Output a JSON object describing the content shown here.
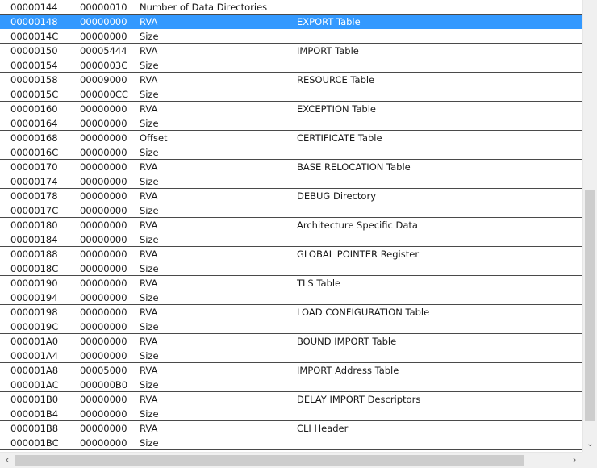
{
  "rows": [
    {
      "offset": "00000144",
      "data": "00000010",
      "desc": "Number of Data Directories",
      "value": ""
    },
    {
      "offset": "00000148",
      "data": "00000000",
      "desc": "RVA",
      "value": "EXPORT Table"
    },
    {
      "offset": "0000014C",
      "data": "00000000",
      "desc": "Size",
      "value": ""
    },
    {
      "offset": "00000150",
      "data": "00005444",
      "desc": "RVA",
      "value": "IMPORT Table"
    },
    {
      "offset": "00000154",
      "data": "0000003C",
      "desc": "Size",
      "value": ""
    },
    {
      "offset": "00000158",
      "data": "00009000",
      "desc": "RVA",
      "value": "RESOURCE Table"
    },
    {
      "offset": "0000015C",
      "data": "000000CC",
      "desc": "Size",
      "value": ""
    },
    {
      "offset": "00000160",
      "data": "00000000",
      "desc": "RVA",
      "value": "EXCEPTION Table"
    },
    {
      "offset": "00000164",
      "data": "00000000",
      "desc": "Size",
      "value": ""
    },
    {
      "offset": "00000168",
      "data": "00000000",
      "desc": "Offset",
      "value": "CERTIFICATE Table"
    },
    {
      "offset": "0000016C",
      "data": "00000000",
      "desc": "Size",
      "value": ""
    },
    {
      "offset": "00000170",
      "data": "00000000",
      "desc": "RVA",
      "value": "BASE RELOCATION Table"
    },
    {
      "offset": "00000174",
      "data": "00000000",
      "desc": "Size",
      "value": ""
    },
    {
      "offset": "00000178",
      "data": "00000000",
      "desc": "RVA",
      "value": "DEBUG Directory"
    },
    {
      "offset": "0000017C",
      "data": "00000000",
      "desc": "Size",
      "value": ""
    },
    {
      "offset": "00000180",
      "data": "00000000",
      "desc": "RVA",
      "value": "Architecture Specific Data"
    },
    {
      "offset": "00000184",
      "data": "00000000",
      "desc": "Size",
      "value": ""
    },
    {
      "offset": "00000188",
      "data": "00000000",
      "desc": "RVA",
      "value": "GLOBAL POINTER Register"
    },
    {
      "offset": "0000018C",
      "data": "00000000",
      "desc": "Size",
      "value": ""
    },
    {
      "offset": "00000190",
      "data": "00000000",
      "desc": "RVA",
      "value": "TLS Table"
    },
    {
      "offset": "00000194",
      "data": "00000000",
      "desc": "Size",
      "value": ""
    },
    {
      "offset": "00000198",
      "data": "00000000",
      "desc": "RVA",
      "value": "LOAD CONFIGURATION Table"
    },
    {
      "offset": "0000019C",
      "data": "00000000",
      "desc": "Size",
      "value": ""
    },
    {
      "offset": "000001A0",
      "data": "00000000",
      "desc": "RVA",
      "value": "BOUND IMPORT Table"
    },
    {
      "offset": "000001A4",
      "data": "00000000",
      "desc": "Size",
      "value": ""
    },
    {
      "offset": "000001A8",
      "data": "00005000",
      "desc": "RVA",
      "value": "IMPORT Address Table"
    },
    {
      "offset": "000001AC",
      "data": "000000B0",
      "desc": "Size",
      "value": ""
    },
    {
      "offset": "000001B0",
      "data": "00000000",
      "desc": "RVA",
      "value": "DELAY IMPORT Descriptors"
    },
    {
      "offset": "000001B4",
      "data": "00000000",
      "desc": "Size",
      "value": ""
    },
    {
      "offset": "000001B8",
      "data": "00000000",
      "desc": "RVA",
      "value": "CLI Header"
    },
    {
      "offset": "000001BC",
      "data": "00000000",
      "desc": "Size",
      "value": ""
    }
  ],
  "selected_index": 1,
  "scrollbar": {
    "down_arrow_icon": "chevron-down-icon",
    "left_arrow_icon": "chevron-left-icon",
    "right_arrow_icon": "chevron-right-icon"
  },
  "colors": {
    "selection": "#3399ff",
    "selection_text": "#ffffff",
    "separator": "#4a4a4a"
  }
}
